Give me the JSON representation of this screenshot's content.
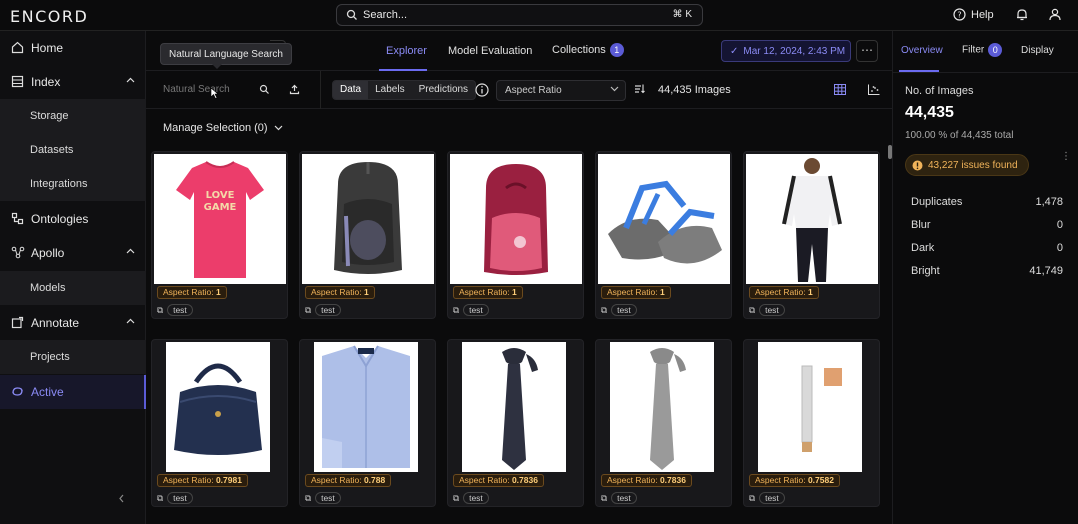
{
  "app": {
    "logo": "ENCORD"
  },
  "topbar": {
    "search_placeholder": "Search...",
    "search_shortcut": "⌘ K",
    "help_label": "Help"
  },
  "sidebar": {
    "items": [
      {
        "label": "Home",
        "icon": "home-icon"
      },
      {
        "label": "Index",
        "icon": "index-icon",
        "expanded": true
      },
      {
        "label": "Storage",
        "sub": true
      },
      {
        "label": "Datasets",
        "sub": true
      },
      {
        "label": "Integrations",
        "sub": true
      },
      {
        "label": "Ontologies",
        "icon": "ontologies-icon"
      },
      {
        "label": "Apollo",
        "icon": "apollo-icon",
        "expanded": true
      },
      {
        "label": "Models",
        "sub": true
      },
      {
        "label": "Annotate",
        "icon": "annotate-icon",
        "expanded": true
      },
      {
        "label": "Projects",
        "sub": true
      },
      {
        "label": "Active",
        "icon": "active-icon",
        "active": true
      }
    ]
  },
  "main": {
    "tooltip": "Natural Language Search",
    "tabs": [
      {
        "label": "Explorer",
        "active": true
      },
      {
        "label": "Model Evaluation"
      },
      {
        "label": "Collections",
        "badge": "1"
      }
    ],
    "date": "Mar 12, 2024, 2:43 PM",
    "toolbar": {
      "search_placeholder": "Natural Search",
      "segments": [
        "Data",
        "Labels",
        "Predictions"
      ],
      "sort_by": "Aspect Ratio",
      "count": "44,435 Images"
    },
    "manage_selection": "Manage Selection (0)",
    "cards": [
      {
        "ar_label": "Aspect Ratio:",
        "ar_value": "1",
        "tag": "test",
        "kind": "tshirt"
      },
      {
        "ar_label": "Aspect Ratio:",
        "ar_value": "1",
        "tag": "test",
        "kind": "backpack-black"
      },
      {
        "ar_label": "Aspect Ratio:",
        "ar_value": "1",
        "tag": "test",
        "kind": "backpack-red"
      },
      {
        "ar_label": "Aspect Ratio:",
        "ar_value": "1",
        "tag": "test",
        "kind": "sandals"
      },
      {
        "ar_label": "Aspect Ratio:",
        "ar_value": "1",
        "tag": "test",
        "kind": "tracksuit"
      },
      {
        "ar_label": "Aspect Ratio:",
        "ar_value": "0.7981",
        "tag": "test",
        "kind": "handbag"
      },
      {
        "ar_label": "Aspect Ratio:",
        "ar_value": "0.788",
        "tag": "test",
        "kind": "shirt"
      },
      {
        "ar_label": "Aspect Ratio:",
        "ar_value": "0.7836",
        "tag": "test",
        "kind": "tie-dark"
      },
      {
        "ar_label": "Aspect Ratio:",
        "ar_value": "0.7836",
        "tag": "test",
        "kind": "tie-grey"
      },
      {
        "ar_label": "Aspect Ratio:",
        "ar_value": "0.7582",
        "tag": "test",
        "kind": "cosmetic"
      }
    ]
  },
  "right_panel": {
    "tabs": [
      {
        "label": "Overview",
        "active": true
      },
      {
        "label": "Filter",
        "badge": "0"
      },
      {
        "label": "Display"
      }
    ],
    "title": "No. of Images",
    "total": "44,435",
    "percent": "100.00 % of 44,435 total",
    "issues": "43,227 issues found",
    "metrics": [
      {
        "label": "Duplicates",
        "value": "1,478"
      },
      {
        "label": "Blur",
        "value": "0"
      },
      {
        "label": "Dark",
        "value": "0"
      },
      {
        "label": "Bright",
        "value": "41,749"
      }
    ]
  },
  "colors": {
    "accent": "#6b6bf0",
    "warning": "#f0b35a",
    "background": "#0b0b0c"
  }
}
